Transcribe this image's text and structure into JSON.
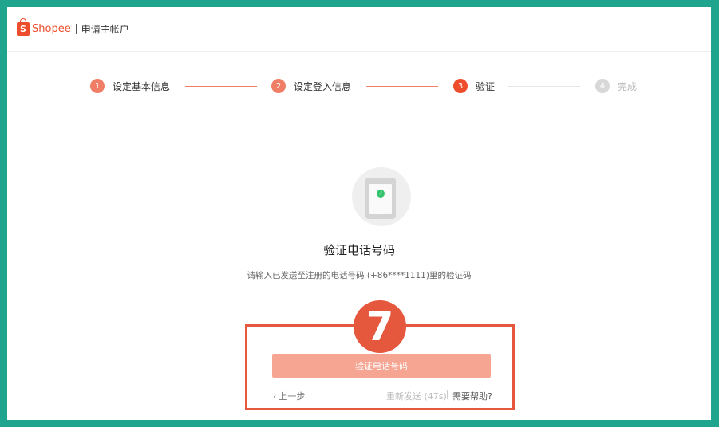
{
  "header": {
    "brand": "Shopee",
    "logo_letter": "S",
    "title": "申请主帐户"
  },
  "steps": [
    {
      "num": "1",
      "label": "设定基本信息",
      "state": "done"
    },
    {
      "num": "2",
      "label": "设定登入信息",
      "state": "done"
    },
    {
      "num": "3",
      "label": "验证",
      "state": "active"
    },
    {
      "num": "4",
      "label": "完成",
      "state": "todo"
    }
  ],
  "verify": {
    "check_glyph": "✓",
    "title": "验证电话号码",
    "description": "请输入已发送至注册的电话号码 (+86****1111)里的验证码",
    "code_length": 6
  },
  "actions": {
    "submit_label": "验证电话号码",
    "back_label": "上一步",
    "back_chevron": "‹",
    "resend_label": "重新发送 (47s)",
    "help_label": "需要帮助?"
  },
  "annotation": {
    "badge_number": "7"
  },
  "colors": {
    "brand": "#ee4d2d",
    "step_done": "#f07e66",
    "button_disabled": "#f6a593",
    "annotation": "#e5583e",
    "frame": "#1fa58e"
  }
}
